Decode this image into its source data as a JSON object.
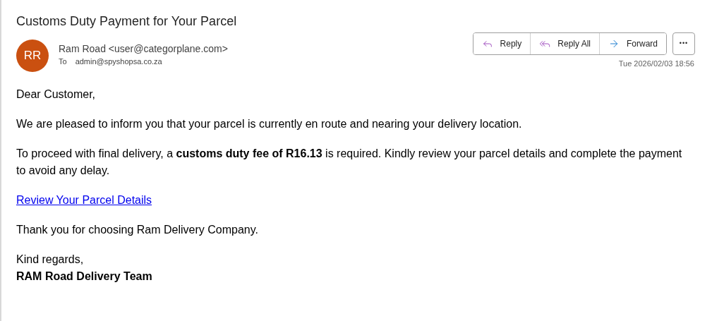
{
  "subject": "Customs Duty Payment for Your Parcel",
  "sender": {
    "initials": "RR",
    "name": "Ram Road <user@categorplane.com>",
    "to_label": "To",
    "to": "admin@spyshopsa.co.za",
    "date": "Tue 2026/02/03 18:56"
  },
  "actions": [
    {
      "kind": "reply",
      "label": "Reply"
    },
    {
      "kind": "reply_all",
      "label": "Reply All"
    },
    {
      "kind": "forward",
      "label": "Forward"
    }
  ],
  "more_button": {
    "label": "•••"
  },
  "body": [
    {
      "kind": "text",
      "text": "Dear Customer,"
    },
    {
      "kind": "text",
      "text": "We are pleased to inform you that your parcel is currently en route and nearing your delivery location."
    },
    {
      "kind": "text",
      "text": "To proceed with final delivery, a **customs duty fee of R16.13** is required. Kindly review your parcel details and complete the payment to avoid any delay."
    },
    {
      "kind": "link",
      "text": "Review Your Parcel Details"
    },
    {
      "kind": "text",
      "text": "Thank you for choosing Ram Delivery Company."
    }
  ],
  "signature": {
    "closing": "Kind regards,",
    "team": "RAM Road Delivery Team"
  }
}
